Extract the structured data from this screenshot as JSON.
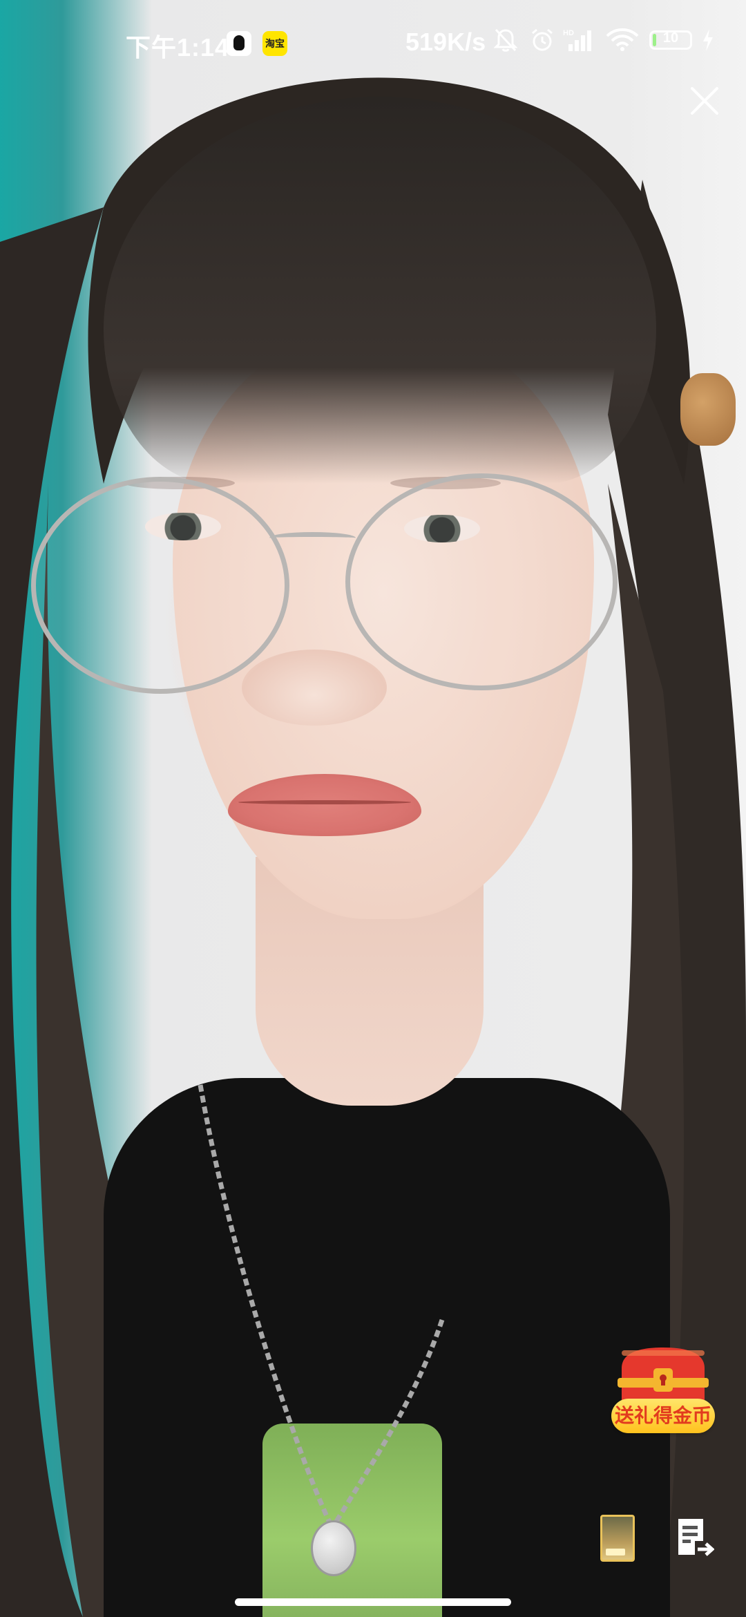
{
  "status_bar": {
    "time": "下午1:14",
    "network_speed": "519K/s",
    "battery_level": "10",
    "battery_fraction": 0.1,
    "app_badge_text": "淘宝",
    "icons": [
      "qq-icon",
      "app-icon",
      "bell-muted-icon",
      "alarm-icon",
      "hd-signal-icon",
      "wifi-icon",
      "battery-icon",
      "charging-icon"
    ]
  },
  "overlay": {
    "close_icon": "close-icon",
    "gift_label": "送礼得金币",
    "gift_icon": "treasure-chest-icon",
    "card_icon": "card-thumbnail-icon",
    "share_icon": "document-share-icon"
  },
  "colors": {
    "gift_label_text": "#e23b1e",
    "gift_label_bg": "#ffc21e",
    "chest_red": "#e5382d",
    "chest_gold": "#f4b62f"
  }
}
